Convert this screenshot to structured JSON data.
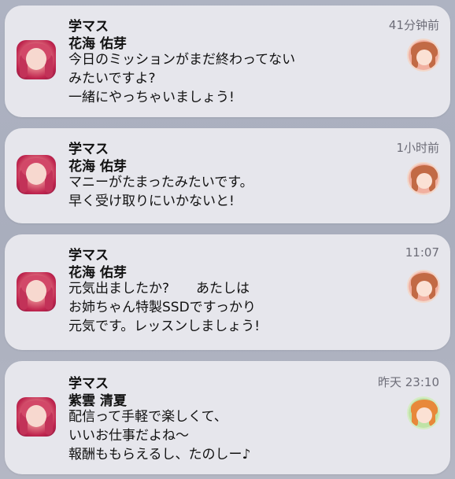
{
  "notifications": [
    {
      "app": "学マス",
      "sender": "花海 佑芽",
      "time": "41分钟前",
      "lines": [
        "今日のミッションがまだ終わってない",
        "みたいですよ?",
        "一緒にやっちゃいましょう!"
      ],
      "avatar_hair_color": "#c26a45",
      "avatar_bg_color": "#f1b0a0"
    },
    {
      "app": "学マス",
      "sender": "花海 佑芽",
      "time": "1小时前",
      "lines": [
        "マニーがたまったみたいです。",
        "早く受け取りにいかないと!"
      ],
      "avatar_hair_color": "#c26a45",
      "avatar_bg_color": "#f1b0a0"
    },
    {
      "app": "学マス",
      "sender": "花海 佑芽",
      "time": "11:07",
      "lines": [
        "元気出ましたか?　　あたしは",
        "お姉ちゃん特製SSDですっかり",
        "元気です。レッスンしましょう!"
      ],
      "avatar_hair_color": "#c26a45",
      "avatar_bg_color": "#f1b0a0"
    },
    {
      "app": "学マス",
      "sender": "紫雲 清夏",
      "time": "昨天 23:10",
      "lines": [
        "配信って手軽で楽しくて、",
        "いいお仕事だよね〜",
        "報酬ももらえるし、たのしー♪"
      ],
      "avatar_hair_color": "#e8883a",
      "avatar_bg_color": "#bfe3a6"
    }
  ],
  "colors": {
    "card_bg": "#e6e6ec",
    "time_text": "#6d6d78",
    "app_icon_accent": "#c0264f"
  },
  "icons": {
    "app": "app-icon",
    "sender_avatar": "avatar"
  }
}
